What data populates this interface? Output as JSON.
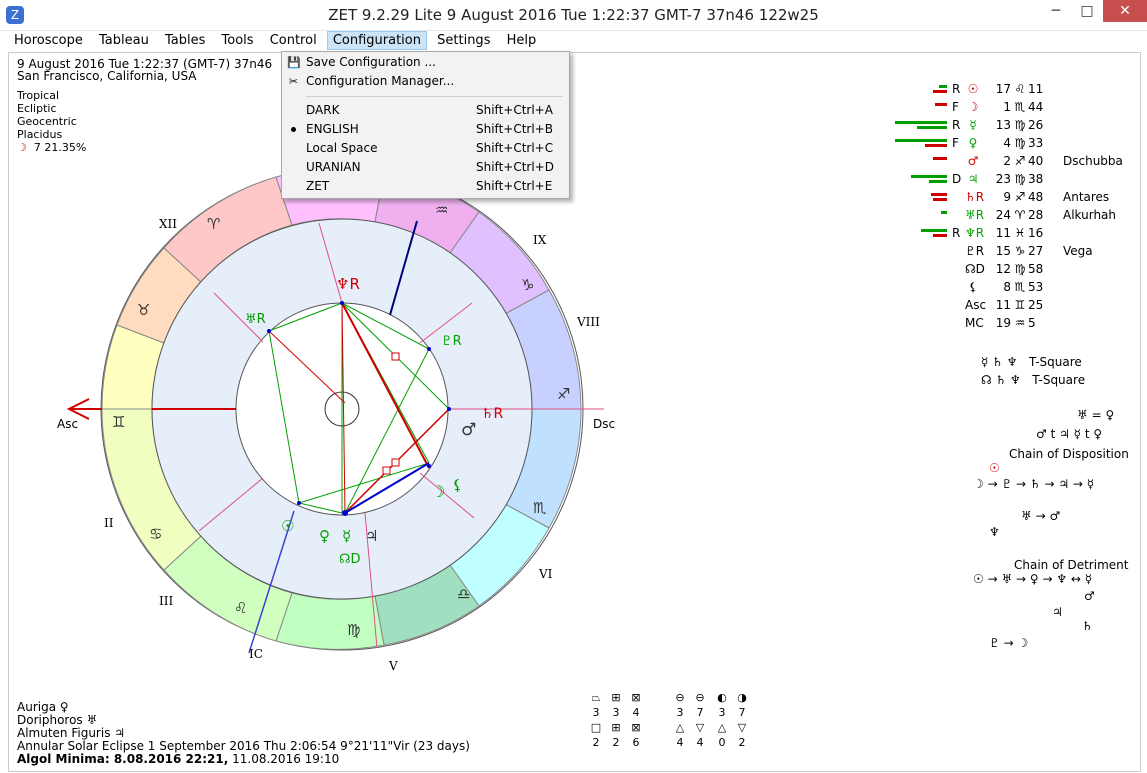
{
  "window": {
    "title": "ZET 9.2.29 Lite     9 August 2016   Tue    1:22:37 GMT-7 37n46  122w25",
    "minimize": "─",
    "maximize": "□",
    "close": "✕",
    "app_icon": "Z"
  },
  "menu": [
    "Horoscope",
    "Tableau",
    "Tables",
    "Tools",
    "Control",
    "Configuration",
    "Settings",
    "Help"
  ],
  "config_menu": {
    "save": "Save Configuration ...",
    "manager": "Configuration Manager...",
    "items": [
      {
        "label": "DARK",
        "shortcut": "Shift+Ctrl+A",
        "checked": false
      },
      {
        "label": "ENGLISH",
        "shortcut": "Shift+Ctrl+B",
        "checked": true
      },
      {
        "label": "Local Space",
        "shortcut": "Shift+Ctrl+C",
        "checked": false
      },
      {
        "label": "URANIAN",
        "shortcut": "Shift+Ctrl+D",
        "checked": false
      },
      {
        "label": "ZET",
        "shortcut": "Shift+Ctrl+E",
        "checked": false
      }
    ]
  },
  "chart_info": {
    "date_line": "9 August 2016   Tue    1:22:37 (GMT-7) 37n46",
    "place": "San Francisco, California, USA",
    "settings": [
      "Tropical",
      "Ecliptic",
      "Geocentric",
      "Placidus"
    ],
    "moon_phase": "7 21.35%"
  },
  "wheel": {
    "houses": [
      "XII",
      "IX",
      "VIII",
      "Dsc",
      "VI",
      "V",
      "IC",
      "III",
      "II",
      "Asc"
    ],
    "signs": [
      "♈",
      "♉",
      "♊",
      "♋",
      "♌",
      "♍",
      "♎",
      "♏",
      "♐",
      "♑",
      "♒"
    ]
  },
  "planets": [
    {
      "rf": "R",
      "glyph": "☉",
      "deg": "17",
      "sign": "♌",
      "min": "11",
      "star": "",
      "color": "#d00000"
    },
    {
      "rf": "F",
      "glyph": "☽",
      "deg": "1",
      "sign": "♏",
      "min": "44",
      "star": "",
      "color": "#d00000"
    },
    {
      "rf": "R",
      "glyph": "☿",
      "deg": "13",
      "sign": "♍",
      "min": "26",
      "star": "",
      "color": "#00a000"
    },
    {
      "rf": "F",
      "glyph": "♀",
      "deg": "4",
      "sign": "♍",
      "min": "33",
      "star": "",
      "color": "#00a000"
    },
    {
      "rf": "",
      "glyph": "♂",
      "deg": "2",
      "sign": "♐",
      "min": "40",
      "star": "Dschubba",
      "color": "#d00000"
    },
    {
      "rf": "D",
      "glyph": "♃",
      "deg": "23",
      "sign": "♍",
      "min": "38",
      "star": "",
      "color": "#00a000"
    },
    {
      "rf": "",
      "glyph": "♄R",
      "deg": "9",
      "sign": "♐",
      "min": "48",
      "star": "Antares",
      "color": "#d00000"
    },
    {
      "rf": "",
      "glyph": "♅R",
      "deg": "24",
      "sign": "♈",
      "min": "28",
      "star": "Alkurhah",
      "color": "#00a000"
    },
    {
      "rf": "R",
      "glyph": "♆R",
      "deg": "11",
      "sign": "♓",
      "min": "16",
      "star": "",
      "color": "#00a000"
    },
    {
      "rf": "",
      "glyph": "♇R",
      "deg": "15",
      "sign": "♑",
      "min": "27",
      "star": "Vega",
      "color": "#000000"
    },
    {
      "rf": "",
      "glyph": "☊D",
      "deg": "12",
      "sign": "♍",
      "min": "58",
      "star": "",
      "color": "#000000"
    },
    {
      "rf": "",
      "glyph": "⚸",
      "deg": "8",
      "sign": "♏",
      "min": "53",
      "star": "",
      "color": "#000000"
    },
    {
      "rf": "",
      "glyph": "Asc",
      "deg": "11",
      "sign": "♊",
      "min": "25",
      "star": "",
      "color": "#000000"
    },
    {
      "rf": "",
      "glyph": "MC",
      "deg": "19",
      "sign": "♒",
      "min": "5",
      "star": "",
      "color": "#000000"
    }
  ],
  "patterns": [
    {
      "glyphs": "☿ ♄ ♆",
      "label": "T-Square"
    },
    {
      "glyphs": "☊ ♄ ♆",
      "label": "T-Square"
    }
  ],
  "mutual": [
    "♅ = ♀",
    "♂ t ♃  ☿ t ♀"
  ],
  "chain_disposition": {
    "title": "Chain of Disposition",
    "lines": [
      "☉",
      "☽ → ♇ → ♄ → ♃ → ☿",
      "♅ → ♂",
      "♆"
    ]
  },
  "chain_detriment": {
    "title": "Chain of Detriment",
    "lines": [
      "☉ → ♅ → ♀ → ♆ ↔ ☿",
      "♃",
      "♂",
      "♄",
      "♇ → ☽"
    ]
  },
  "bottom_left": {
    "auriga": "Auriga  ♀",
    "doriphoros": "Doriphoros  ♅",
    "almuten": "Almuten Figuris  ♃",
    "eclipse": "Annular Solar Eclipse 1 September 2016 Thu  2:06:54  9°21'11\"Vir (23 days)",
    "algol_bold": "Algol Minima: 8.08.2016 22:21,",
    "algol_rest": "  11.08.2016 19:10"
  },
  "element_table": {
    "row1_icons": [
      "⏢",
      "⊞",
      "⊠",
      "⊖",
      "⊖",
      "◐",
      "◑"
    ],
    "row1_vals": [
      "3",
      "3",
      "4",
      "3",
      "7",
      "3",
      "7"
    ],
    "row2_icons": [
      "□",
      "⊞",
      "⊠",
      "△",
      "▽",
      "△",
      "▽"
    ],
    "row2_vals": [
      "2",
      "2",
      "6",
      "4",
      "4",
      "0",
      "2"
    ]
  }
}
